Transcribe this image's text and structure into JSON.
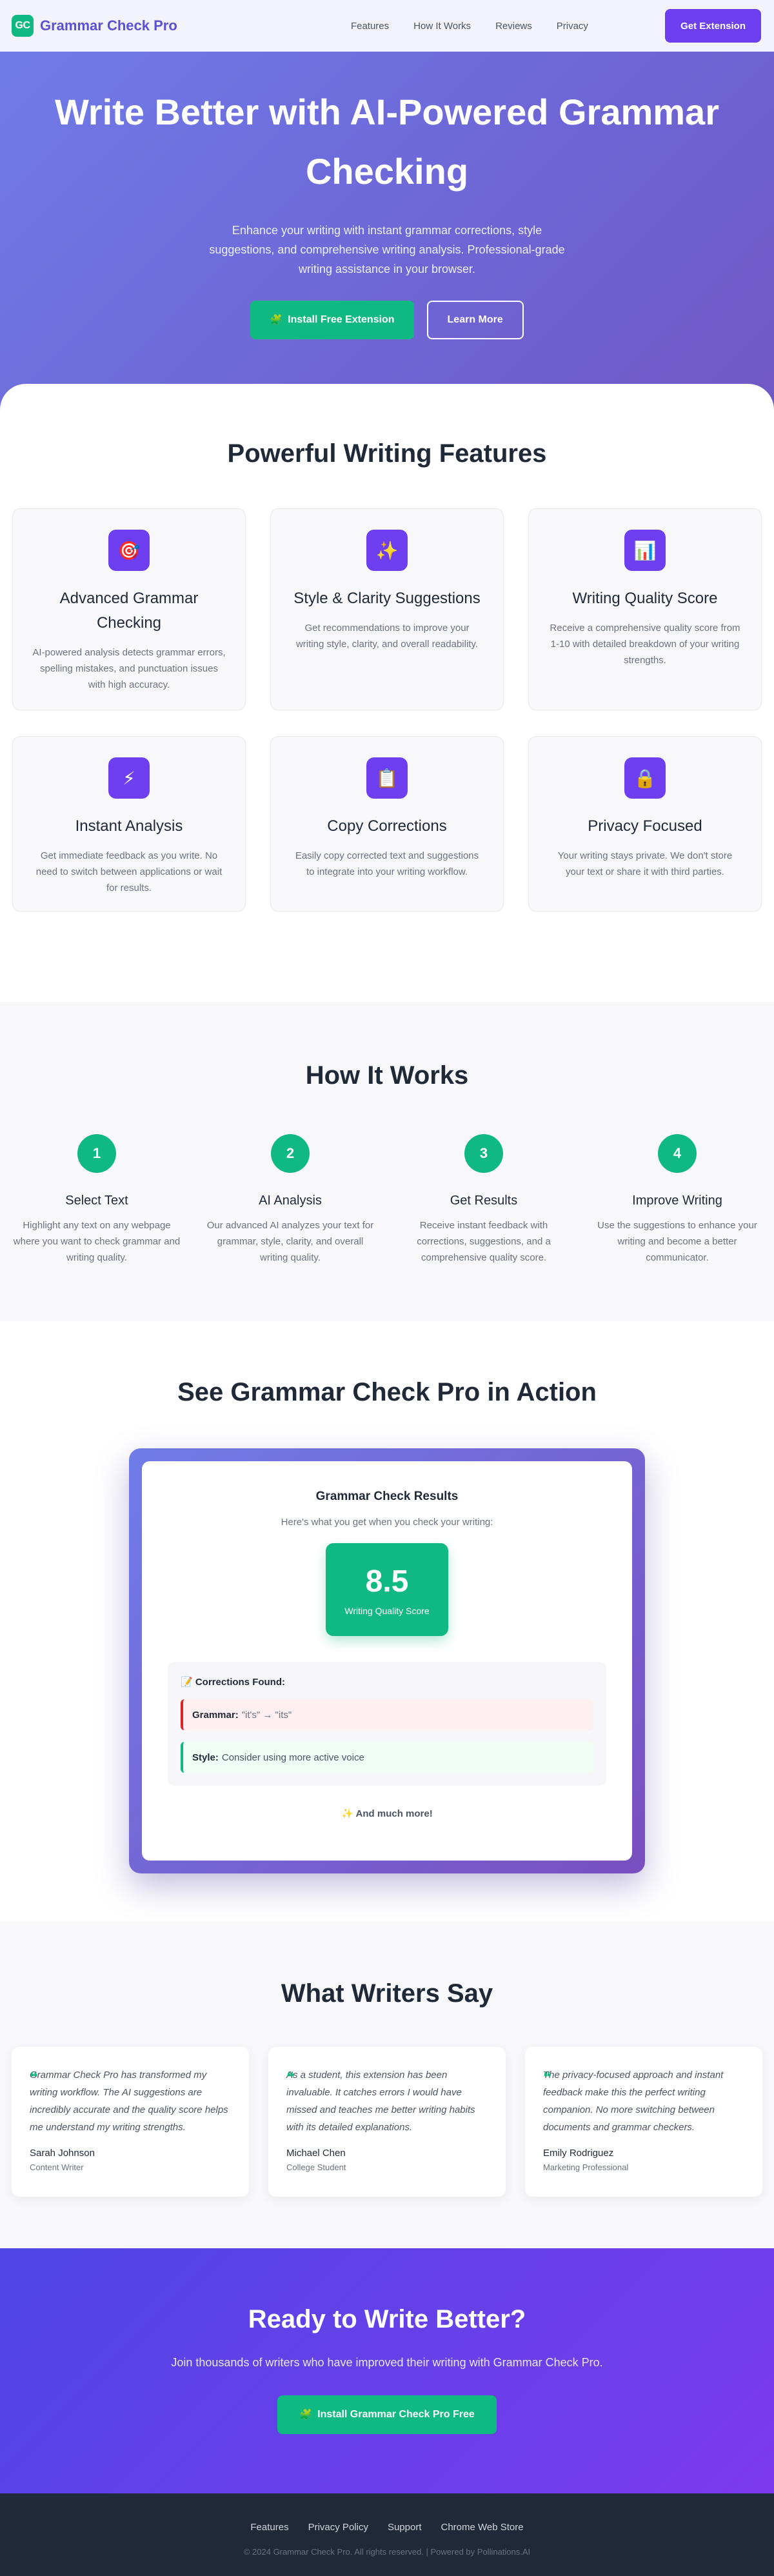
{
  "nav": {
    "logo": "GC",
    "brand": "Grammar Check Pro",
    "links": [
      "Features",
      "How It Works",
      "Reviews",
      "Privacy"
    ],
    "cta": "Get Extension"
  },
  "hero": {
    "title": "Write Better with AI-Powered Grammar Checking",
    "subtitle": "Enhance your writing with instant grammar corrections, style suggestions, and comprehensive writing analysis. Professional-grade writing assistance in your browser.",
    "primary_icon": "🧩",
    "primary_button": "Install Free Extension",
    "secondary_button": "Learn More"
  },
  "features": {
    "title": "Powerful Writing Features",
    "items": [
      {
        "icon": "🎯",
        "icon_name": "target-icon",
        "title": "Advanced Grammar Checking",
        "desc": "AI-powered analysis detects grammar errors, spelling mistakes, and punctuation issues with high accuracy."
      },
      {
        "icon": "✨",
        "icon_name": "sparkles-icon",
        "title": "Style & Clarity Suggestions",
        "desc": "Get recommendations to improve your writing style, clarity, and overall readability."
      },
      {
        "icon": "📊",
        "icon_name": "chart-icon",
        "title": "Writing Quality Score",
        "desc": "Receive a comprehensive quality score from 1-10 with detailed breakdown of your writing strengths."
      },
      {
        "icon": "⚡",
        "icon_name": "lightning-icon",
        "title": "Instant Analysis",
        "desc": "Get immediate feedback as you write. No need to switch between applications or wait for results."
      },
      {
        "icon": "📋",
        "icon_name": "clipboard-icon",
        "title": "Copy Corrections",
        "desc": "Easily copy corrected text and suggestions to integrate into your writing workflow."
      },
      {
        "icon": "🔒",
        "icon_name": "lock-icon",
        "title": "Privacy Focused",
        "desc": "Your writing stays private. We don't store your text or share it with third parties."
      }
    ]
  },
  "how": {
    "title": "How It Works",
    "steps": [
      {
        "num": "1",
        "title": "Select Text",
        "desc": "Highlight any text on any webpage where you want to check grammar and writing quality."
      },
      {
        "num": "2",
        "title": "AI Analysis",
        "desc": "Our advanced AI analyzes your text for grammar, style, clarity, and overall writing quality."
      },
      {
        "num": "3",
        "title": "Get Results",
        "desc": "Receive instant feedback with corrections, suggestions, and a comprehensive quality score."
      },
      {
        "num": "4",
        "title": "Improve Writing",
        "desc": "Use the suggestions to enhance your writing and become a better communicator."
      }
    ]
  },
  "action": {
    "title": "See Grammar Check Pro in Action",
    "card_title": "Grammar Check Results",
    "card_sub": "Here's what you get when you check your writing:",
    "score": "8.5",
    "score_label": "Writing Quality Score",
    "corrections_title": "📝 Corrections Found:",
    "grammar_label": "Grammar:",
    "grammar_value": "\"it's\" → \"its\"",
    "style_label": "Style:",
    "style_value": "Consider using more active voice",
    "more": "✨ And much more!"
  },
  "testimonials": {
    "title": "What Writers Say",
    "quote_mark": "❝",
    "items": [
      {
        "text": "Grammar Check Pro has transformed my writing workflow. The AI suggestions are incredibly accurate and the quality score helps me understand my writing strengths.",
        "name": "Sarah Johnson",
        "role": "Content Writer"
      },
      {
        "text": "As a student, this extension has been invaluable. It catches errors I would have missed and teaches me better writing habits with its detailed explanations.",
        "name": "Michael Chen",
        "role": "College Student"
      },
      {
        "text": "The privacy-focused approach and instant feedback make this the perfect writing companion. No more switching between documents and grammar checkers.",
        "name": "Emily Rodriguez",
        "role": "Marketing Professional"
      }
    ]
  },
  "cta": {
    "title": "Ready to Write Better?",
    "text": "Join thousands of writers who have improved their writing with Grammar Check Pro.",
    "icon": "🧩",
    "button": "Install Grammar Check Pro Free"
  },
  "footer": {
    "links": [
      "Features",
      "Privacy Policy",
      "Support",
      "Chrome Web Store"
    ],
    "copyright": "© 2024 Grammar Check Pro. All rights reserved. | Powered by Pollinations.AI"
  },
  "colors": {
    "accent": "#6d3ff0",
    "success": "#10b981",
    "brand_text": "#5b4fd6"
  }
}
